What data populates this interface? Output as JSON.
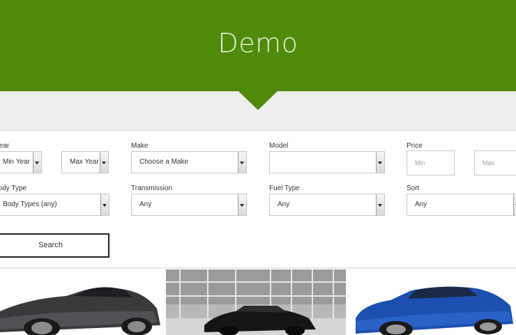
{
  "hero": {
    "title": "Demo"
  },
  "search": {
    "year": {
      "label": "Year",
      "min": "Min Year",
      "max": "Max Year"
    },
    "make": {
      "label": "Make",
      "value": "Choose a Make"
    },
    "model": {
      "label": "Model",
      "value": ""
    },
    "price": {
      "label": "Price",
      "min_placeholder": "Min",
      "max_placeholder": "Max"
    },
    "body_type": {
      "label": "Body Type",
      "value": "Body Types (any)"
    },
    "transmission": {
      "label": "Transmission",
      "value": "Any"
    },
    "fuel_type": {
      "label": "Fuel Type",
      "value": "Any"
    },
    "sort": {
      "label": "Sort",
      "value": "Any"
    },
    "button_label": "Search"
  },
  "colors": {
    "brand_green": "#4f8a0b",
    "band_gray": "#efefef"
  },
  "listings": [
    {
      "image": "dark-gray-coupe"
    },
    {
      "image": "black-sedan-building"
    },
    {
      "image": "blue-coupe"
    }
  ]
}
